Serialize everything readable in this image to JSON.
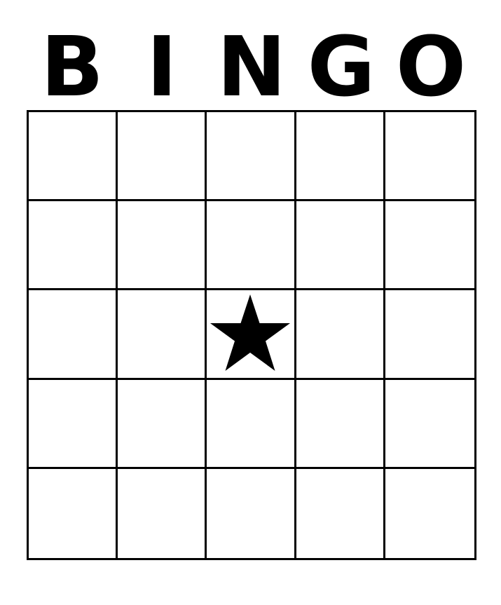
{
  "header": {
    "letters": [
      "B",
      "I",
      "N",
      "G",
      "O"
    ]
  },
  "grid": {
    "rows": 5,
    "columns": 5,
    "free_space_icon": "star-icon",
    "free_space_color": "#000000",
    "line_color": "#000000",
    "background_color": "#ffffff"
  }
}
